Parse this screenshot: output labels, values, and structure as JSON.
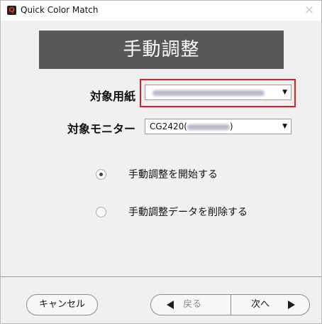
{
  "window": {
    "title": "Quick Color Match",
    "app_icon_letter": "Q",
    "close_glyph": "×"
  },
  "header": {
    "title": "手動調整"
  },
  "form": {
    "paper_label": "対象用紙",
    "monitor_label": "対象モニター",
    "monitor_value_prefix": "CG2420(",
    "monitor_value_suffix": ")",
    "dropdown_arrow": "▼"
  },
  "options": [
    {
      "label": "手動調整を開始する",
      "selected": true
    },
    {
      "label": "手動調整データを削除する",
      "selected": false
    }
  ],
  "footer": {
    "cancel_label": "キャンセル",
    "back_label": "戻る",
    "next_label": "次へ"
  },
  "colors": {
    "highlight": "#d81e2a",
    "banner": "#585858",
    "background": "#f0f0f0"
  },
  "icons": {
    "app": "app-logo-icon",
    "close": "close-icon",
    "back": "triangle-left-icon",
    "next": "triangle-right-icon",
    "dropdown": "chevron-down-icon"
  }
}
